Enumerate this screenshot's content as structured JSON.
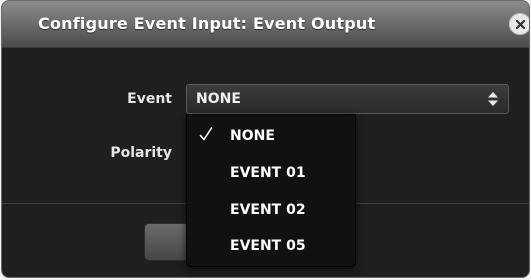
{
  "dialog": {
    "title": "Configure Event Input: Event Output"
  },
  "form": {
    "event_label": "Event",
    "polarity_label": "Polarity",
    "event_value": "NONE"
  },
  "dropdown": {
    "selected": "NONE",
    "options": [
      {
        "label": "NONE",
        "checked": true
      },
      {
        "label": "EVENT 01",
        "checked": false
      },
      {
        "label": "EVENT 02",
        "checked": false
      },
      {
        "label": "EVENT 05",
        "checked": false
      }
    ]
  },
  "icons": {
    "close": "close-icon",
    "select_arrows": "up-down-arrows-icon",
    "check": "checkmark-icon"
  },
  "colors": {
    "dialog_bg": "#1f1f1f",
    "titlebar_top": "#8b8b8b",
    "text": "#ffffff"
  }
}
